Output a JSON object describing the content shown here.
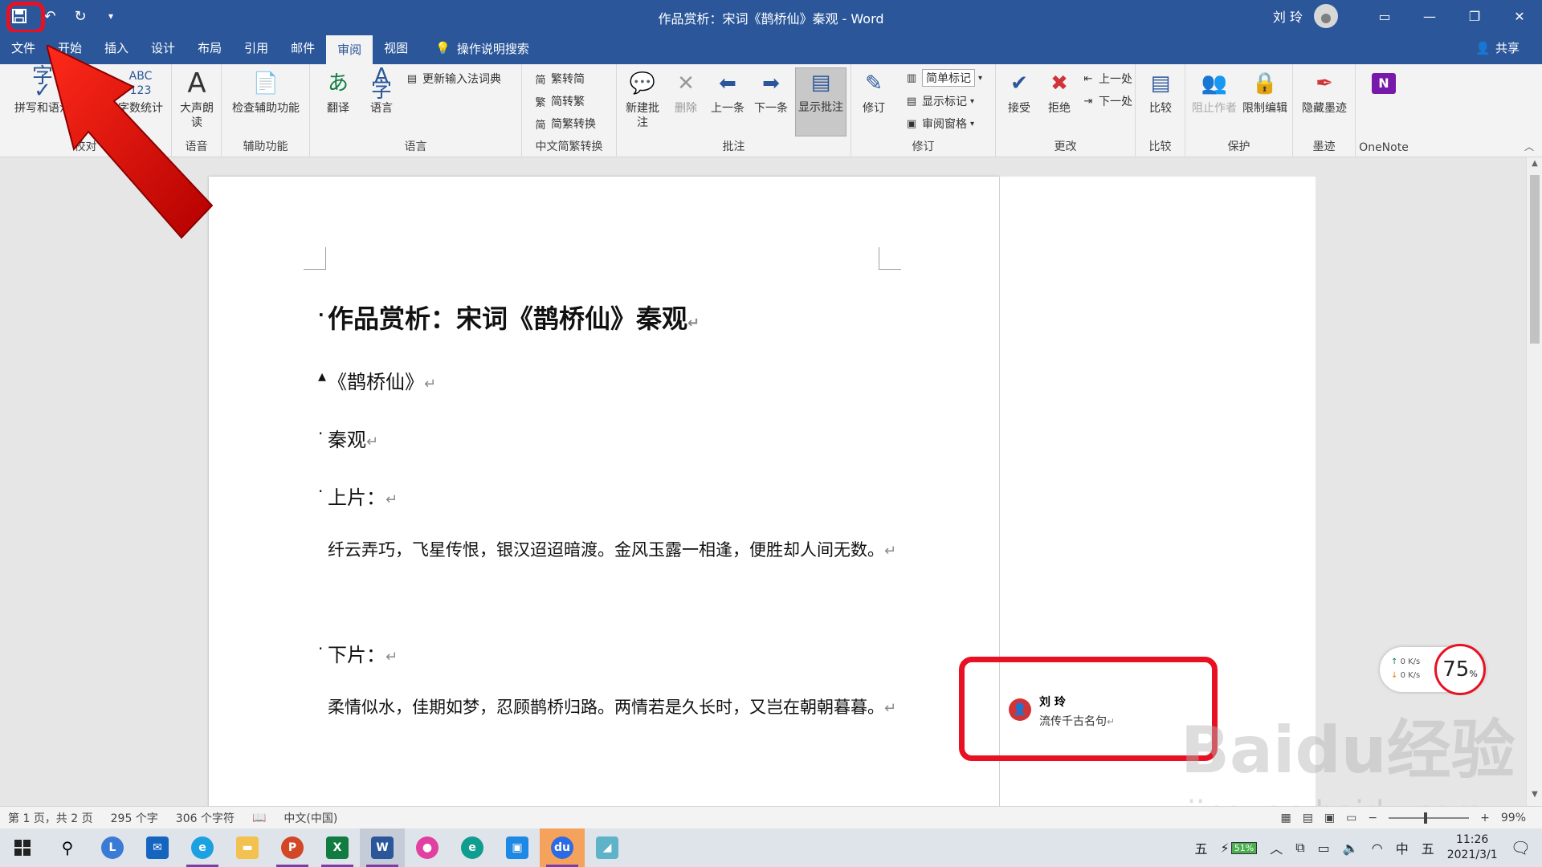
{
  "titlebar": {
    "title": "作品赏析：宋词《鹊桥仙》秦观  -  Word",
    "user": "刘 玲",
    "qat": {
      "save": "💾",
      "undo": "↶",
      "redo": "↻",
      "more": "▾"
    }
  },
  "tabs": [
    "文件",
    "开始",
    "插入",
    "设计",
    "布局",
    "引用",
    "邮件",
    "审阅",
    "视图"
  ],
  "active_tab": "审阅",
  "tell_me": "操作说明搜索",
  "share": "共享",
  "ribbon": {
    "proofing": {
      "label": "校对",
      "spell": "拼写和语法",
      "wordcount": "字数统计"
    },
    "speech": {
      "label": "语音",
      "read_aloud": "大声朗读"
    },
    "accessibility": {
      "label": "辅助功能",
      "check": "检查辅助功能"
    },
    "language": {
      "label": "语言",
      "translate": "翻译",
      "language": "语言",
      "update_ime": "更新输入法词典"
    },
    "chinese": {
      "label": "中文简繁转换",
      "to_simp": "繁转简",
      "to_trad": "简转繁",
      "convert": "简繁转换"
    },
    "comments": {
      "label": "批注",
      "new": "新建批注",
      "delete": "删除",
      "prev": "上一条",
      "next": "下一条",
      "show": "显示批注"
    },
    "tracking": {
      "label": "修订",
      "track": "修订",
      "markup": "简单标记",
      "show_markup": "显示标记",
      "pane": "审阅窗格"
    },
    "changes": {
      "label": "更改",
      "accept": "接受",
      "reject": "拒绝",
      "prev": "上一处",
      "next": "下一处"
    },
    "compare": {
      "label": "比较",
      "compare": "比较"
    },
    "protect": {
      "label": "保护",
      "block": "阻止作者",
      "restrict": "限制编辑"
    },
    "ink": {
      "label": "墨迹",
      "hide": "隐藏墨迹"
    },
    "onenote": {
      "label": "OneNote"
    }
  },
  "document": {
    "title": "作品赏析：宋词《鹊桥仙》秦观",
    "poem_title": "《鹊桥仙》",
    "author": "秦观",
    "part1_label": "上片：",
    "part1_text": "纤云弄巧，飞星传恨，银汉迢迢暗渡。金风玉露一相逢，便胜却人间无数。",
    "part2_label": "下片：",
    "part2_text": "柔情似水，佳期如梦，忍顾鹊桥归路。两情若是久长时，又岂在朝朝暮暮。",
    "return_mark": "↵"
  },
  "comment": {
    "author": "刘 玲",
    "text": "流传千古名句"
  },
  "speed_widget": {
    "up": "0  K/s",
    "down": "0  K/s",
    "percent": "75",
    "percent_unit": "%"
  },
  "statusbar": {
    "page": "第 1 页，共 2 页",
    "words": "295 个字",
    "chars": "306 个字符",
    "lang": "中文(中国)",
    "zoom": "99%",
    "zoom_minus": "−",
    "zoom_plus": "+"
  },
  "taskbar": {
    "tray_ime": "五",
    "battery": "51%",
    "lang": "中",
    "ime2": "五",
    "time": "11:26",
    "date": "2021/3/1"
  },
  "watermark": {
    "main": "Baidu经验",
    "url": "jingyan.baidu.com"
  },
  "colors": {
    "word_blue": "#2b579a",
    "highlight_red": "#e81123"
  }
}
